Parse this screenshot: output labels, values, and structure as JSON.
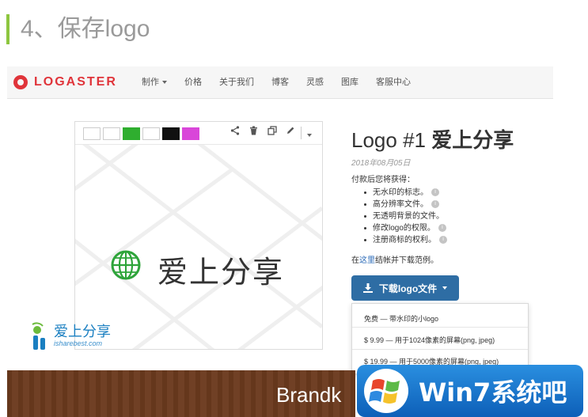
{
  "step_title": "4、保存logo",
  "navbar": {
    "brand": "LOGASTER",
    "items": [
      "制作",
      "价格",
      "关于我们",
      "博客",
      "灵感",
      "图库",
      "客服中心"
    ]
  },
  "preview": {
    "logo_text": "爱上分享",
    "tools": [
      "share-icon",
      "trash-icon",
      "copy-icon",
      "pencil-icon",
      "chevron-down-icon"
    ],
    "thumbnail_colors": [
      "#ffffff",
      "#ffffff",
      "#2fae2f",
      "#ffffff",
      "#111111",
      "#d946d9"
    ]
  },
  "info": {
    "title_prefix": "Logo #1",
    "title_name": "爱上分享",
    "date": "2018年08月05日",
    "intro": "付款后您将获得：",
    "benefits": [
      "无水印的标志。",
      "高分辨率文件。",
      "无透明背景的文件。",
      "修改logo的权限。",
      "注册商标的权利。"
    ],
    "example_pre": "在",
    "example_link": "这里",
    "example_post": "结帐并下载范例。"
  },
  "download": {
    "label": "下载logo文件",
    "options": [
      "免费 — 带水印的小logo",
      "$ 9.99 — 用于1024像素的屏幕(png, jpeg)",
      "$ 19.99 — 用于5000像素的屏幕(png, jpeg)"
    ]
  },
  "watermark": {
    "cn": "爱上分享",
    "url": "isharebest.com"
  },
  "banner_text": "Brandk",
  "win7_text": "Win7系统吧",
  "colors": {
    "accent_green": "#8dc63f",
    "brand_red": "#e0343a",
    "button_blue": "#2e6da4"
  }
}
